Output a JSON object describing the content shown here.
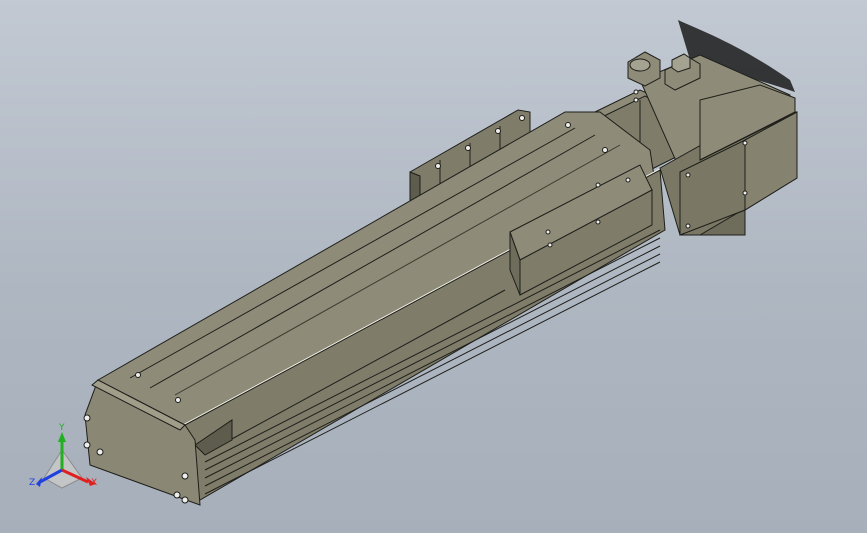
{
  "viewport": {
    "background_top": "#c2c9d3",
    "background_bottom": "#a7afbb"
  },
  "model": {
    "body_color": "#7f7d6a",
    "body_light": "#8e8c78",
    "body_dark": "#5d5c4d",
    "highlight": "#f0f0e6",
    "edge": "#1e1e1a",
    "shadow": "#1b1b1b"
  },
  "triad": {
    "x_label": "X",
    "y_label": "Y",
    "z_label": "Z",
    "x_color": "#e02020",
    "y_color": "#20b020",
    "z_color": "#2040e0"
  }
}
